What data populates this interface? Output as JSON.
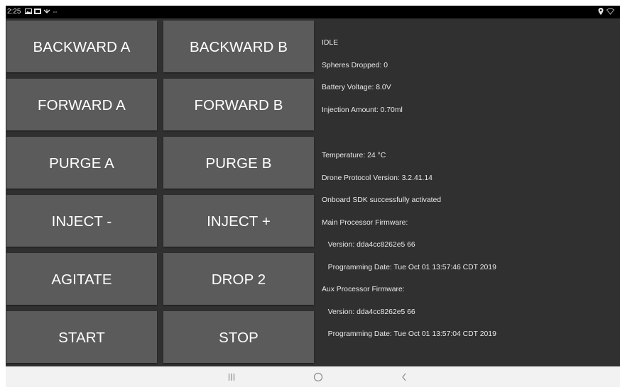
{
  "status_bar": {
    "time": "2:25",
    "left_icons": [
      "gallery-icon",
      "image-icon",
      "usb-icon",
      "more-icon"
    ],
    "right_icons": [
      "location-icon",
      "wifi-icon"
    ]
  },
  "buttons": [
    {
      "id": "backward-a",
      "label": "BACKWARD A"
    },
    {
      "id": "backward-b",
      "label": "BACKWARD B"
    },
    {
      "id": "forward-a",
      "label": "FORWARD A"
    },
    {
      "id": "forward-b",
      "label": "FORWARD B"
    },
    {
      "id": "purge-a",
      "label": "PURGE A"
    },
    {
      "id": "purge-b",
      "label": "PURGE B"
    },
    {
      "id": "inject-minus",
      "label": "INJECT -"
    },
    {
      "id": "inject-plus",
      "label": "INJECT +"
    },
    {
      "id": "agitate",
      "label": "AGITATE"
    },
    {
      "id": "drop-2",
      "label": "DROP 2"
    },
    {
      "id": "start",
      "label": "START"
    },
    {
      "id": "stop",
      "label": "STOP"
    }
  ],
  "info": {
    "state": "IDLE",
    "spheres_dropped": "Spheres Dropped: 0",
    "battery_voltage": "Battery Voltage: 8.0V",
    "injection_amount": "Injection Amount: 0.70ml",
    "temperature": "Temperature: 24 °C",
    "protocol_version": "Drone Protocol Version: 3.2.41.14",
    "sdk_status": "Onboard SDK successfully activated",
    "main_fw_title": "Main Processor Firmware:",
    "main_fw_version": "   Version: dda4cc8262e5 66",
    "main_fw_date": "   Programming Date: Tue Oct 01 13:57:46 CDT 2019",
    "aux_fw_title": "Aux Processor Firmware:",
    "aux_fw_version": "   Version: dda4cc8262e5 66",
    "aux_fw_date": "   Programming Date: Tue Oct 01 13:57:04 CDT 2019"
  },
  "nav_bar": {
    "recents_icon": "recents-icon",
    "home_icon": "home-icon",
    "back_icon": "back-icon"
  },
  "colors": {
    "background": "#303030",
    "button": "#5b5b5b",
    "status_bar": "#000000",
    "nav_bar": "#f2f2f2"
  }
}
